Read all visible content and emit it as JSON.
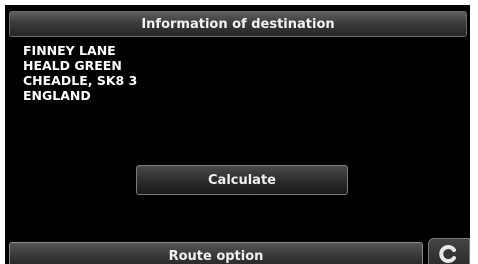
{
  "screen": {
    "title": "Information of destination",
    "address_lines": [
      "FINNEY LANE",
      "HEALD GREEN",
      "CHEADLE, SK8 3",
      "ENGLAND"
    ],
    "calculate_label": "Calculate",
    "route_option_label": "Route option",
    "corner_icon": "refresh-icon"
  }
}
